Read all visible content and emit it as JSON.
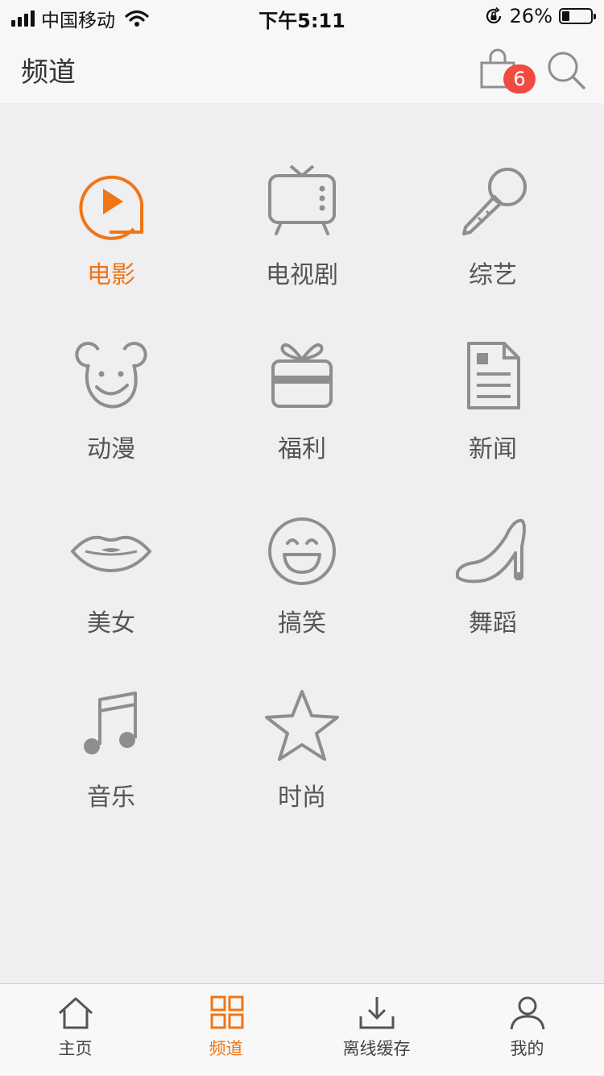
{
  "status_bar": {
    "carrier": "中国移动",
    "time": "下午5:11",
    "battery_percent": "26%",
    "battery_level": 0.26
  },
  "header": {
    "title": "频道",
    "cart_badge": "6",
    "cart_icon": "shopping-bag-icon",
    "search_icon": "search-icon"
  },
  "channels": [
    {
      "label": "电影",
      "icon": "movie-play-icon",
      "active": true
    },
    {
      "label": "电视剧",
      "icon": "tv-icon",
      "active": false
    },
    {
      "label": "综艺",
      "icon": "microphone-icon",
      "active": false
    },
    {
      "label": "动漫",
      "icon": "cartoon-mouse-icon",
      "active": false
    },
    {
      "label": "福利",
      "icon": "gift-icon",
      "active": false
    },
    {
      "label": "新闻",
      "icon": "newspaper-icon",
      "active": false
    },
    {
      "label": "美女",
      "icon": "lips-icon",
      "active": false
    },
    {
      "label": "搞笑",
      "icon": "laughing-face-icon",
      "active": false
    },
    {
      "label": "舞蹈",
      "icon": "high-heel-icon",
      "active": false
    },
    {
      "label": "音乐",
      "icon": "music-note-icon",
      "active": false
    },
    {
      "label": "时尚",
      "icon": "star-icon",
      "active": false
    }
  ],
  "tabbar": [
    {
      "label": "主页",
      "icon": "home-icon",
      "active": false
    },
    {
      "label": "频道",
      "icon": "grid-icon",
      "active": true
    },
    {
      "label": "离线缓存",
      "icon": "download-icon",
      "active": false
    },
    {
      "label": "我的",
      "icon": "user-icon",
      "active": false
    }
  ],
  "colors": {
    "accent": "#f07516",
    "icon_gray": "#8e8e90",
    "badge": "#f04b41",
    "background": "#efeef0"
  }
}
